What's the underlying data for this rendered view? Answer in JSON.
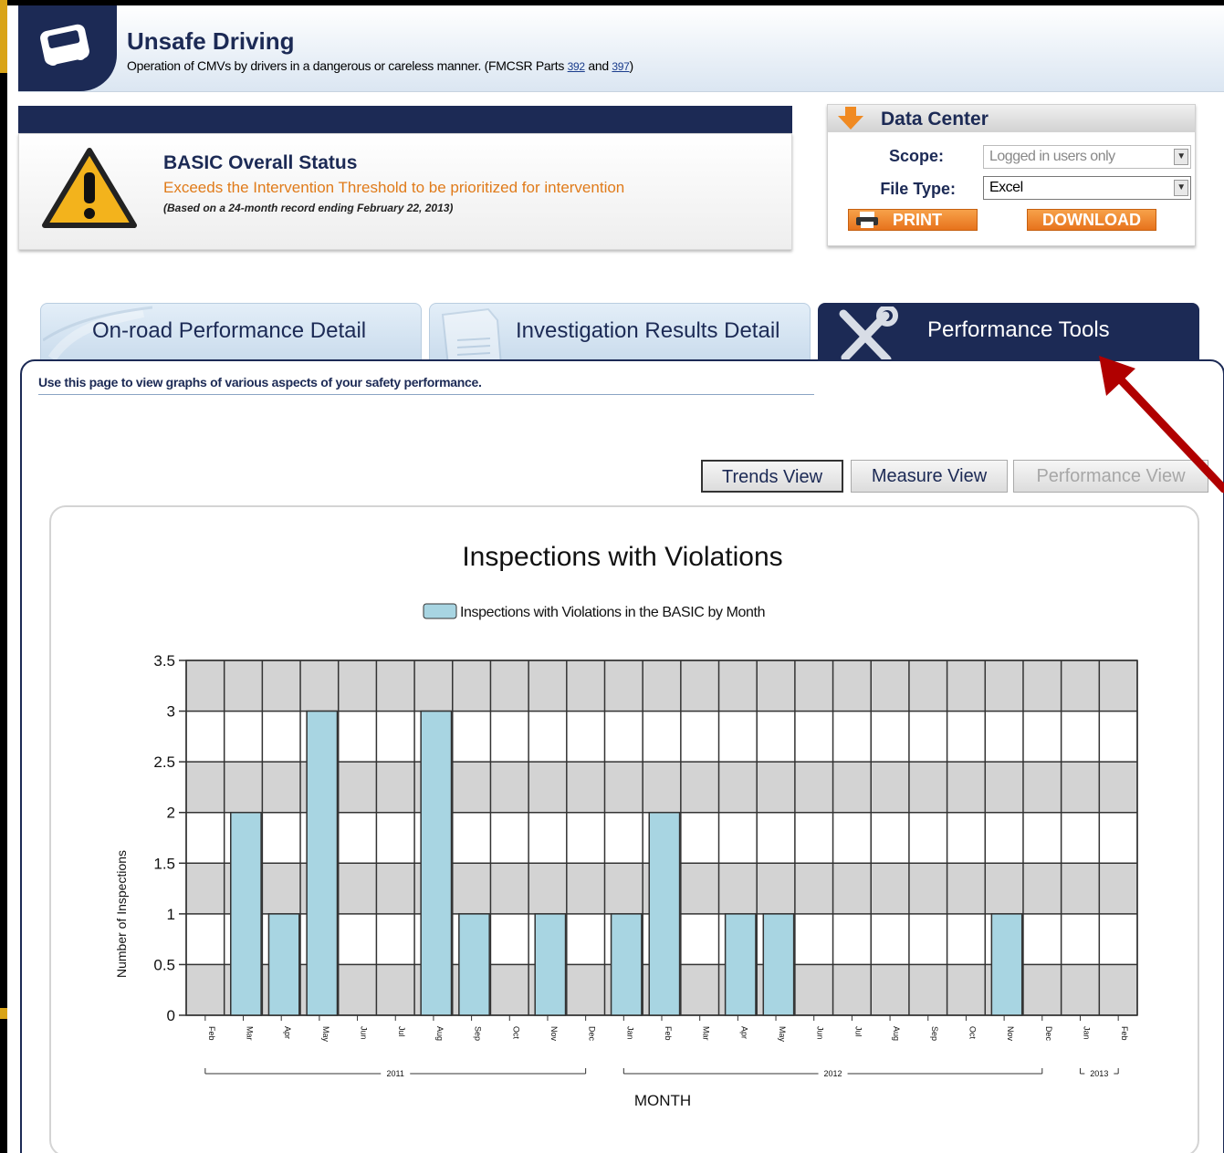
{
  "header": {
    "title": "Unsafe Driving",
    "subtitle": "Operation of CMVs by drivers in a dangerous or careless manner. (FMCSR Parts ",
    "link1": "392",
    "and_text": " and ",
    "link2": "397",
    "close": ")",
    "icon": "truck-icon"
  },
  "status": {
    "title": "BASIC Overall Status",
    "text": "Exceeds the Intervention Threshold to be prioritized for intervention",
    "note": "(Based on a 24-month record ending February 22, 2013)",
    "icon": "warning-icon"
  },
  "data_center": {
    "title": "Data Center",
    "scope_label": "Scope:",
    "scope_value": "Logged in users only",
    "filetype_label": "File Type:",
    "filetype_value": "Excel",
    "print_label": "PRINT",
    "download_label": "DOWNLOAD"
  },
  "tabs": [
    {
      "label": "On-road Performance Detail"
    },
    {
      "label": "Investigation Results Detail"
    },
    {
      "label": "Performance Tools"
    }
  ],
  "content": {
    "intro": "Use this page to view graphs of various aspects of your safety performance.",
    "views": {
      "trends": "Trends View",
      "measure": "Measure View",
      "performance": "Performance View"
    }
  },
  "colors": {
    "navy": "#1c2a55",
    "orange": "#e07b1a",
    "bar": "#a8d5e2",
    "arrow": "#b00000"
  },
  "chart_data": {
    "type": "bar",
    "title": "Inspections with Violations",
    "xlabel": "MONTH",
    "ylabel": "Number of Inspections",
    "ylim": [
      0,
      3.5
    ],
    "yticks": [
      "0",
      "0.5",
      "1",
      "1.5",
      "2",
      "2.5",
      "3",
      "3.5"
    ],
    "grid": true,
    "legend": "top-center",
    "categories": [
      "Feb",
      "Mar",
      "Apr",
      "May",
      "Jun",
      "Jul",
      "Aug",
      "Sep",
      "Oct",
      "Nov",
      "Dec",
      "Jan",
      "Feb",
      "Mar",
      "Apr",
      "May",
      "Jun",
      "Jul",
      "Aug",
      "Sep",
      "Oct",
      "Nov",
      "Dec",
      "Jan",
      "Feb"
    ],
    "year_groups": [
      {
        "label": "2011",
        "from": 0,
        "to": 10
      },
      {
        "label": "2012",
        "from": 11,
        "to": 22
      },
      {
        "label": "2013",
        "from": 23,
        "to": 24
      }
    ],
    "series": [
      {
        "name": "Inspections with Violations in the BASIC by Month",
        "values": [
          0,
          2,
          1,
          3,
          0,
          0,
          3,
          1,
          0,
          1,
          0,
          1,
          2,
          0,
          1,
          1,
          0,
          0,
          0,
          0,
          0,
          1,
          0,
          0,
          0
        ]
      }
    ]
  }
}
